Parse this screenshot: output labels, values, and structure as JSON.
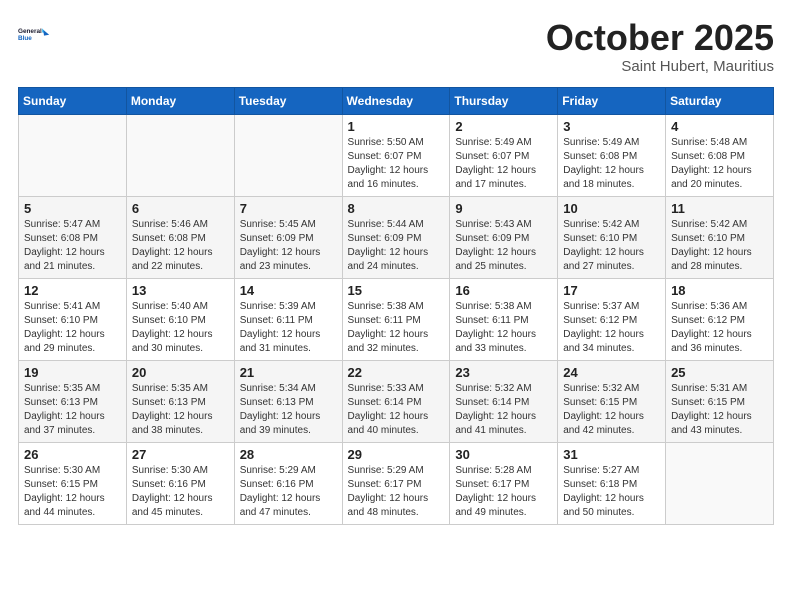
{
  "header": {
    "logo_line1": "General",
    "logo_line2": "Blue",
    "main_title": "October 2025",
    "subtitle": "Saint Hubert, Mauritius"
  },
  "weekdays": [
    "Sunday",
    "Monday",
    "Tuesday",
    "Wednesday",
    "Thursday",
    "Friday",
    "Saturday"
  ],
  "weeks": [
    [
      {
        "day": "",
        "info": ""
      },
      {
        "day": "",
        "info": ""
      },
      {
        "day": "",
        "info": ""
      },
      {
        "day": "1",
        "info": "Sunrise: 5:50 AM\nSunset: 6:07 PM\nDaylight: 12 hours\nand 16 minutes."
      },
      {
        "day": "2",
        "info": "Sunrise: 5:49 AM\nSunset: 6:07 PM\nDaylight: 12 hours\nand 17 minutes."
      },
      {
        "day": "3",
        "info": "Sunrise: 5:49 AM\nSunset: 6:08 PM\nDaylight: 12 hours\nand 18 minutes."
      },
      {
        "day": "4",
        "info": "Sunrise: 5:48 AM\nSunset: 6:08 PM\nDaylight: 12 hours\nand 20 minutes."
      }
    ],
    [
      {
        "day": "5",
        "info": "Sunrise: 5:47 AM\nSunset: 6:08 PM\nDaylight: 12 hours\nand 21 minutes."
      },
      {
        "day": "6",
        "info": "Sunrise: 5:46 AM\nSunset: 6:08 PM\nDaylight: 12 hours\nand 22 minutes."
      },
      {
        "day": "7",
        "info": "Sunrise: 5:45 AM\nSunset: 6:09 PM\nDaylight: 12 hours\nand 23 minutes."
      },
      {
        "day": "8",
        "info": "Sunrise: 5:44 AM\nSunset: 6:09 PM\nDaylight: 12 hours\nand 24 minutes."
      },
      {
        "day": "9",
        "info": "Sunrise: 5:43 AM\nSunset: 6:09 PM\nDaylight: 12 hours\nand 25 minutes."
      },
      {
        "day": "10",
        "info": "Sunrise: 5:42 AM\nSunset: 6:10 PM\nDaylight: 12 hours\nand 27 minutes."
      },
      {
        "day": "11",
        "info": "Sunrise: 5:42 AM\nSunset: 6:10 PM\nDaylight: 12 hours\nand 28 minutes."
      }
    ],
    [
      {
        "day": "12",
        "info": "Sunrise: 5:41 AM\nSunset: 6:10 PM\nDaylight: 12 hours\nand 29 minutes."
      },
      {
        "day": "13",
        "info": "Sunrise: 5:40 AM\nSunset: 6:10 PM\nDaylight: 12 hours\nand 30 minutes."
      },
      {
        "day": "14",
        "info": "Sunrise: 5:39 AM\nSunset: 6:11 PM\nDaylight: 12 hours\nand 31 minutes."
      },
      {
        "day": "15",
        "info": "Sunrise: 5:38 AM\nSunset: 6:11 PM\nDaylight: 12 hours\nand 32 minutes."
      },
      {
        "day": "16",
        "info": "Sunrise: 5:38 AM\nSunset: 6:11 PM\nDaylight: 12 hours\nand 33 minutes."
      },
      {
        "day": "17",
        "info": "Sunrise: 5:37 AM\nSunset: 6:12 PM\nDaylight: 12 hours\nand 34 minutes."
      },
      {
        "day": "18",
        "info": "Sunrise: 5:36 AM\nSunset: 6:12 PM\nDaylight: 12 hours\nand 36 minutes."
      }
    ],
    [
      {
        "day": "19",
        "info": "Sunrise: 5:35 AM\nSunset: 6:13 PM\nDaylight: 12 hours\nand 37 minutes."
      },
      {
        "day": "20",
        "info": "Sunrise: 5:35 AM\nSunset: 6:13 PM\nDaylight: 12 hours\nand 38 minutes."
      },
      {
        "day": "21",
        "info": "Sunrise: 5:34 AM\nSunset: 6:13 PM\nDaylight: 12 hours\nand 39 minutes."
      },
      {
        "day": "22",
        "info": "Sunrise: 5:33 AM\nSunset: 6:14 PM\nDaylight: 12 hours\nand 40 minutes."
      },
      {
        "day": "23",
        "info": "Sunrise: 5:32 AM\nSunset: 6:14 PM\nDaylight: 12 hours\nand 41 minutes."
      },
      {
        "day": "24",
        "info": "Sunrise: 5:32 AM\nSunset: 6:15 PM\nDaylight: 12 hours\nand 42 minutes."
      },
      {
        "day": "25",
        "info": "Sunrise: 5:31 AM\nSunset: 6:15 PM\nDaylight: 12 hours\nand 43 minutes."
      }
    ],
    [
      {
        "day": "26",
        "info": "Sunrise: 5:30 AM\nSunset: 6:15 PM\nDaylight: 12 hours\nand 44 minutes."
      },
      {
        "day": "27",
        "info": "Sunrise: 5:30 AM\nSunset: 6:16 PM\nDaylight: 12 hours\nand 45 minutes."
      },
      {
        "day": "28",
        "info": "Sunrise: 5:29 AM\nSunset: 6:16 PM\nDaylight: 12 hours\nand 47 minutes."
      },
      {
        "day": "29",
        "info": "Sunrise: 5:29 AM\nSunset: 6:17 PM\nDaylight: 12 hours\nand 48 minutes."
      },
      {
        "day": "30",
        "info": "Sunrise: 5:28 AM\nSunset: 6:17 PM\nDaylight: 12 hours\nand 49 minutes."
      },
      {
        "day": "31",
        "info": "Sunrise: 5:27 AM\nSunset: 6:18 PM\nDaylight: 12 hours\nand 50 minutes."
      },
      {
        "day": "",
        "info": ""
      }
    ]
  ]
}
